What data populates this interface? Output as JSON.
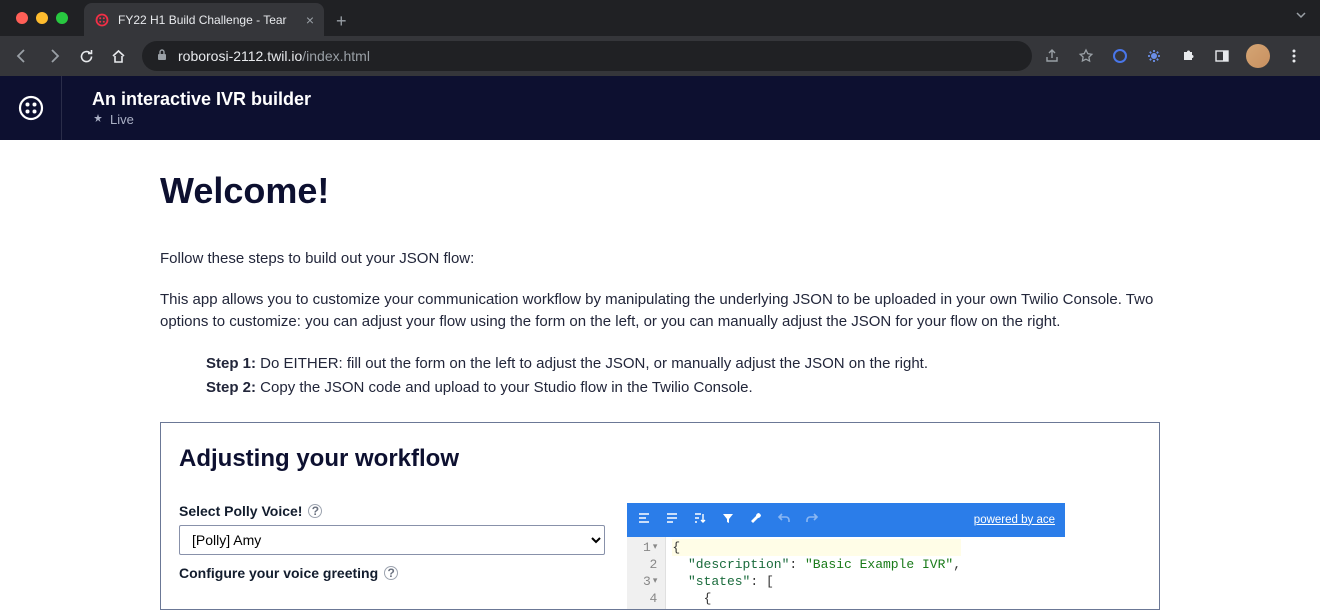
{
  "browser": {
    "tab_title": "FY22 H1 Build Challenge - Tear",
    "url_domain": "roborosi-2112.twil.io",
    "url_path": "/index.html"
  },
  "header": {
    "title": "An interactive IVR builder",
    "status": "Live"
  },
  "page": {
    "welcome": "Welcome!",
    "intro1": "Follow these steps to build out your JSON flow:",
    "intro2": "This app allows you to customize your communication workflow by manipulating the underlying JSON to be uploaded in your own Twilio Console. Two options to customize: you can adjust your flow using the form on the left, or you can manually adjust the JSON for your flow on the right.",
    "step1_label": "Step 1:",
    "step1_text": " Do EITHER: fill out the form on the left to adjust the JSON, or manually adjust the JSON on the right.",
    "step2_label": "Step 2:",
    "step2_text": " Copy the JSON code and upload to your Studio flow in the Twilio Console."
  },
  "panel": {
    "title": "Adjusting your workflow",
    "voice_label": "Select Polly Voice!",
    "voice_value": "[Polly] Amy",
    "greeting_label": "Configure your voice greeting"
  },
  "editor": {
    "credit": "powered by ace",
    "lines": {
      "l1_num": "1",
      "l2_num": "2",
      "l3_num": "3",
      "l4_num": "4",
      "l1_code": "{",
      "l2_key": "\"description\"",
      "l2_val": "\"Basic Example IVR\"",
      "l3_key": "\"states\""
    }
  }
}
